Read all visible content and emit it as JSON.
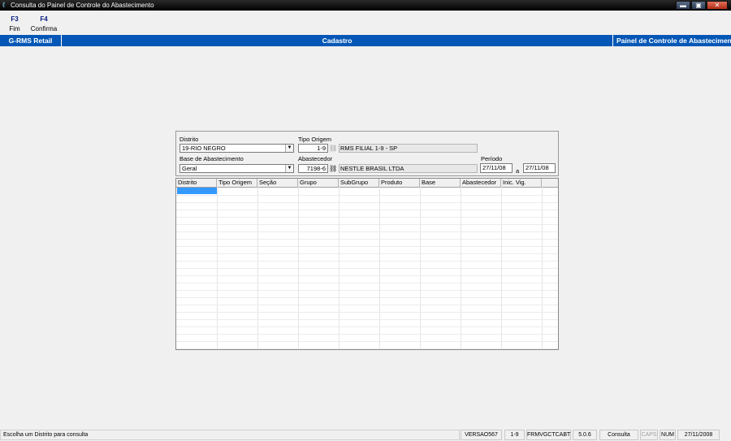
{
  "window": {
    "title": "Consulta do Painel de Controle do Abastecimento",
    "buttons": {
      "minimize": "▬",
      "maximize": "▣",
      "close": "✕"
    }
  },
  "toolbar": {
    "f3": {
      "key": "F3",
      "label": "Fim"
    },
    "f4": {
      "key": "F4",
      "label": "Confirma"
    }
  },
  "nav": {
    "left": "G-RMS Retail",
    "center": "Cadastro",
    "right": "Painel de Controle de Abastecimento"
  },
  "form": {
    "distrito": {
      "label": "Distrito",
      "value": "19-RIO NEGRO"
    },
    "tipo_origem": {
      "label": "Tipo Origem",
      "code": "1-9",
      "description": "RMS FILIAL 1-9 - SP"
    },
    "base": {
      "label": "Base de Abastecimento",
      "value": "Geral"
    },
    "abastecedor": {
      "label": "Abastecedor",
      "code": "7198-6",
      "description": "NESTLE BRASIL LTDA"
    },
    "periodo": {
      "label": "Período",
      "from": "27/11/08",
      "separator": "a",
      "to": "27/11/08"
    }
  },
  "grid": {
    "columns": [
      "Distrito",
      "Tipo Origem",
      "Seção",
      "Grupo",
      "SubGrupo",
      "Produto",
      "Base",
      "Abastecedor",
      "Inic. Vig."
    ]
  },
  "status": {
    "message": "Escolha um Distrito para consulta",
    "version": "VERSAO567",
    "filial": "1-9",
    "form_id": "FRMVGCTCABT",
    "build": "5.0.6",
    "mode": "Consulta",
    "caps": "CAPS",
    "num": "NUM",
    "date": "27/11/2008"
  },
  "colors": {
    "navbar": "#0457b6",
    "selection": "#3399ff"
  }
}
